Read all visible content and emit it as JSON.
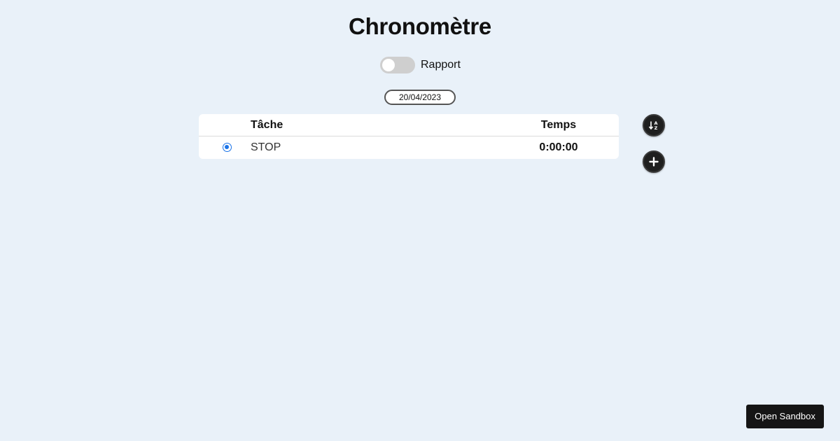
{
  "header": {
    "title": "Chronomètre"
  },
  "report_toggle": {
    "label": "Rapport",
    "checked": false
  },
  "date_filter": {
    "value": "20/04/2023"
  },
  "table": {
    "columns": {
      "task": "Tâche",
      "time": "Temps"
    },
    "rows": [
      {
        "task": "STOP",
        "time": "0:00:00",
        "selected": true
      }
    ]
  },
  "actions": {
    "sort_icon": "sort-alpha-down-icon",
    "add_icon": "plus-icon"
  },
  "sandbox": {
    "label": "Open Sandbox"
  },
  "colors": {
    "accent": "#1a73e8",
    "background": "#e9f1f9",
    "button": "#1f1f1f"
  }
}
